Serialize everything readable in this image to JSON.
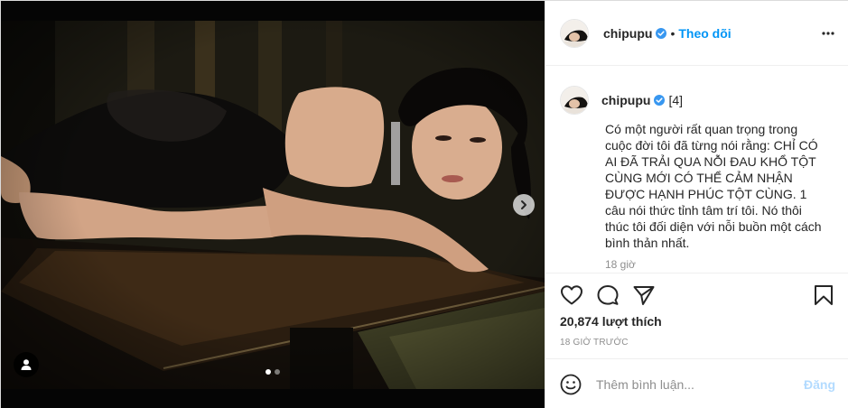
{
  "post": {
    "username": "chipupu",
    "separator": "•",
    "follow_label": "Theo dõi",
    "more_icon": "more-horizontal-icon",
    "caption": {
      "username": "chipupu",
      "tag_count": "[4]",
      "text": "Có một người rất quan trọng trong cuộc đời tôi đã từng nói rằng: CHỈ CÓ AI ĐÃ TRẢI QUA NỖI ĐAU KHỔ TỘT CÙNG MỚI CÓ THỂ CẢM NHẬN ĐƯỢC HẠNH PHÚC TỘT CÙNG. 1 câu nói thức tỉnh tâm trí tôi. Nó thôi thúc tôi đối diện với nỗi buồn một cách bình thản nhất.",
      "time": "18 giờ"
    },
    "likes": "20,874 lượt thích",
    "timestamp": "18 GIỜ TRƯỚC",
    "comment_placeholder": "Thêm bình luận...",
    "post_label": "Đăng"
  },
  "carousel": {
    "total": 2,
    "current": 1
  },
  "icons": [
    "heart-icon",
    "comment-icon",
    "share-icon",
    "bookmark-icon",
    "emoji-icon",
    "verified-icon",
    "chevron-right-icon",
    "user-tag-icon"
  ],
  "colors": {
    "accent": "#0095f6",
    "verified": "#3897f0",
    "muted": "#8e8e8e",
    "disabled_post": "#b3dbff"
  }
}
